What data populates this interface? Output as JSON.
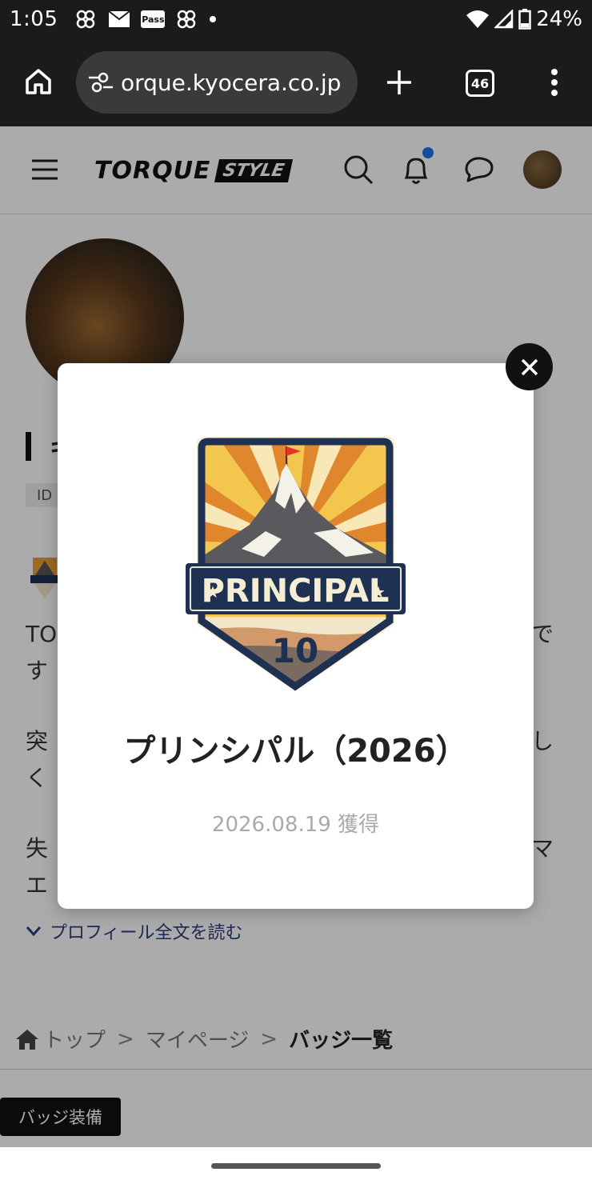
{
  "status_bar": {
    "time": "1:05",
    "pass_label": "Pass",
    "battery": "24%"
  },
  "browser": {
    "url": "orque.kyocera.co.jp",
    "tab_count": "46"
  },
  "site": {
    "logo_main": "TORQUE",
    "logo_sub": "STYLE"
  },
  "profile": {
    "name_fragment": "キ",
    "id_label": "ID",
    "bio_lines": [
      "TOR",
      "す",
      "突",
      "く",
      "失",
      "エ"
    ],
    "bio_tails": [
      "で",
      "し",
      "マ"
    ],
    "read_more": "プロフィール全文を読む"
  },
  "breadcrumb": {
    "home": "トップ",
    "sep": ">",
    "mypage": "マイページ",
    "current": "バッジ一覧"
  },
  "equip_button": "バッジ装備",
  "modal": {
    "badge_text": "PRINCIPAL",
    "badge_number": "10",
    "title": "プリンシパル（2026）",
    "date": "2026.08.19 獲得"
  },
  "colors": {
    "badge_navy": "#1f3152",
    "badge_orange": "#e88a2e",
    "accent_blue": "#1a73e8"
  }
}
